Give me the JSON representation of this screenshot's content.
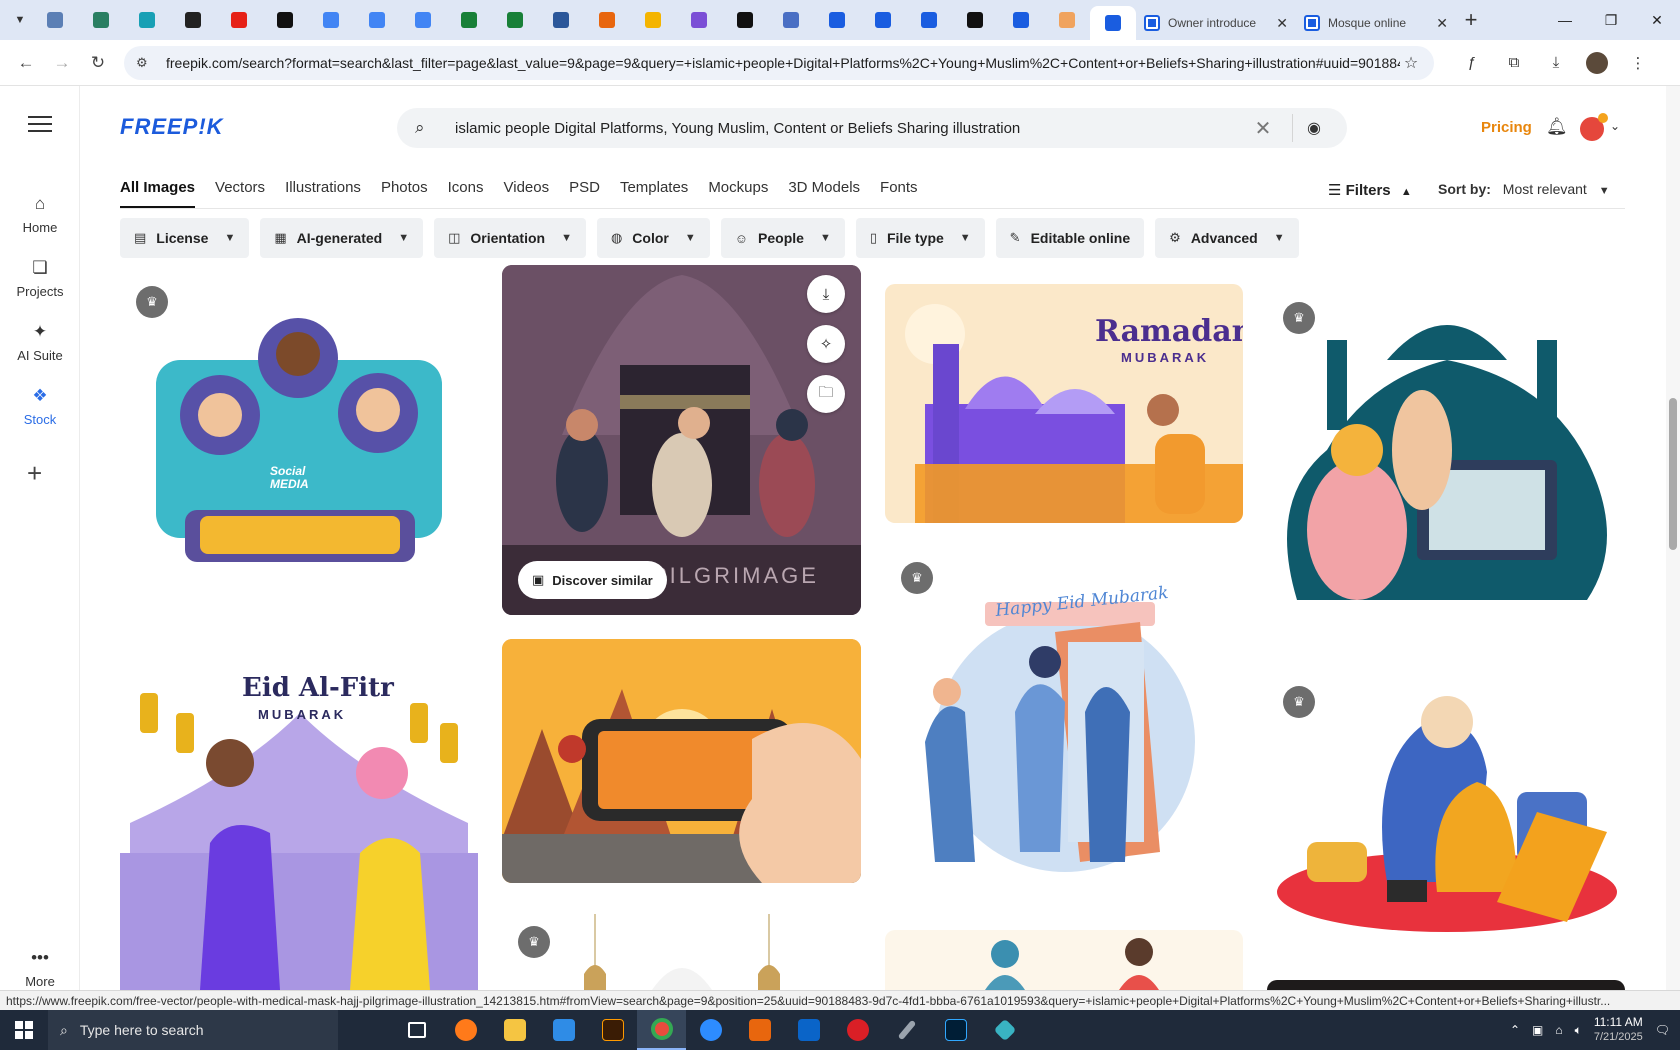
{
  "browser": {
    "tabs": [
      {
        "icon": "globe-icon",
        "color": "#5b7fb5"
      },
      {
        "icon": "shield-icon",
        "color": "#2a7f62"
      },
      {
        "icon": "play-icon",
        "color": "#18a0b5"
      },
      {
        "icon": "openai-icon",
        "color": "#222222"
      },
      {
        "icon": "youtube-icon",
        "color": "#e62117"
      },
      {
        "icon": "bolt-icon",
        "color": "#111111"
      },
      {
        "icon": "docs-icon",
        "color": "#4285f4"
      },
      {
        "icon": "docs-icon",
        "color": "#4285f4"
      },
      {
        "icon": "docs-icon",
        "color": "#4285f4"
      },
      {
        "icon": "sheets-icon",
        "color": "#188038"
      },
      {
        "icon": "sheets-icon",
        "color": "#188038"
      },
      {
        "icon": "word-icon",
        "color": "#2b579a"
      },
      {
        "icon": "app-icon",
        "color": "#e8660e"
      },
      {
        "icon": "bookmark-icon",
        "color": "#f4b400"
      },
      {
        "icon": "brackets-icon",
        "color": "#7b4fd6"
      },
      {
        "icon": "lambda-icon",
        "color": "#111111"
      },
      {
        "icon": "grid-icon",
        "color": "#4a6fc4"
      },
      {
        "icon": "forms-icon",
        "color": "#1a5de0"
      },
      {
        "icon": "forms-icon",
        "color": "#1a5de0"
      },
      {
        "icon": "forms-icon",
        "color": "#1a5de0"
      },
      {
        "icon": "medium-icon",
        "color": "#111111"
      },
      {
        "icon": "forms-icon",
        "color": "#1a5de0"
      },
      {
        "icon": "hand-icon",
        "color": "#f0a35e"
      },
      {
        "icon": "forms-icon",
        "color": "#1a5de0",
        "active": true
      }
    ],
    "labeled_tabs": [
      {
        "title": "Owner introduce",
        "close": "✕"
      },
      {
        "title": "Mosque online",
        "close": "✕"
      }
    ],
    "new_tab": "+",
    "url": "freepik.com/search?format=search&last_filter=page&last_value=9&page=9&query=+islamic+people+Digital+Platforms%2C+Young+Muslim%2C+Content+or+Beliefs+Sharing+illustration#uuid=901884...",
    "status_url": "https://www.freepik.com/free-vector/people-with-medical-mask-hajj-pilgrimage-illustration_14213815.htm#fromView=search&page=9&position=25&uuid=90188483-9d7c-4fd1-bbba-6761a1019593&query=+islamic+people+Digital+Platforms%2C+Young+Muslim%2C+Content+or+Beliefs+Sharing+illustr..."
  },
  "rail": {
    "items": [
      {
        "label": "Home",
        "icon": "home-icon"
      },
      {
        "label": "Projects",
        "icon": "projects-icon"
      },
      {
        "label": "AI Suite",
        "icon": "sparkle-icon"
      },
      {
        "label": "Stock",
        "icon": "stock-icon",
        "active": true
      }
    ],
    "more_label": "More"
  },
  "header": {
    "logo": "FREEP!K",
    "search_query": "islamic people Digital Platforms, Young Muslim, Content or Beliefs Sharing illustration",
    "pricing": "Pricing"
  },
  "type_tabs": [
    "All Images",
    "Vectors",
    "Illustrations",
    "Photos",
    "Icons",
    "Videos",
    "PSD",
    "Templates",
    "Mockups",
    "3D Models",
    "Fonts"
  ],
  "filters": {
    "label": "Filters",
    "sort_label": "Sort by:",
    "sort_value": "Most relevant",
    "chips": [
      {
        "label": "License",
        "icon": "license-icon"
      },
      {
        "label": "AI-generated",
        "icon": "ai-icon"
      },
      {
        "label": "Orientation",
        "icon": "orientation-icon"
      },
      {
        "label": "Color",
        "icon": "palette-icon"
      },
      {
        "label": "People",
        "icon": "people-icon"
      },
      {
        "label": "File type",
        "icon": "file-icon"
      },
      {
        "label": "Editable online",
        "icon": "pencil-icon"
      },
      {
        "label": "Advanced",
        "icon": "gear-icon"
      }
    ]
  },
  "results": {
    "card_social": {
      "label": "Social MEDIA"
    },
    "card_hajj": {
      "label": "PILGRIMAGE",
      "discover": "Discover similar"
    },
    "card_ramadan": {
      "title": "Ramadan",
      "subtitle": "MUBARAK"
    },
    "card_eid_fitr": {
      "title": "Eid Al-Fitr",
      "subtitle": "MUBARAK"
    },
    "card_eid_mubarak": {
      "banner": "Happy Eid Mubarak"
    }
  },
  "taskbar": {
    "search_placeholder": "Type here to search",
    "time": "11:11 AM",
    "date": "7/21/2025"
  }
}
